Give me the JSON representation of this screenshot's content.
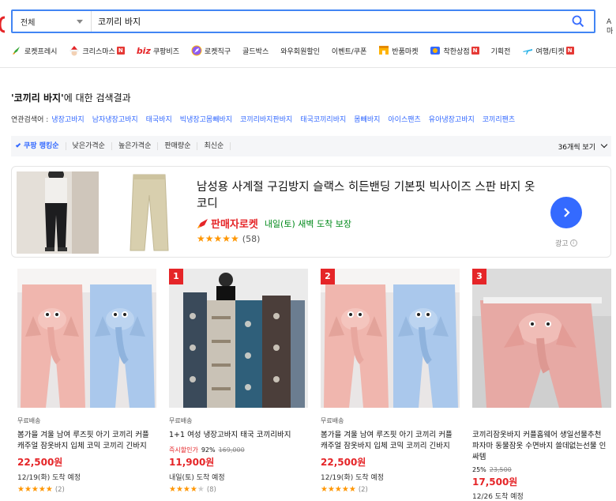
{
  "search": {
    "category": "전체",
    "query": "코끼리 바지"
  },
  "right_edge": {
    "line1": "A",
    "line2": "마"
  },
  "nav": [
    {
      "label": "로켓프레시",
      "icon": "rocket-fresh-icon",
      "badge": ""
    },
    {
      "label": "크리스마스",
      "icon": "santa-icon",
      "badge": "N"
    },
    {
      "label": "쿠팡비즈",
      "icon": "biz-icon",
      "prefix": "biz",
      "badge": ""
    },
    {
      "label": "로켓직구",
      "icon": "rocket-global-icon",
      "badge": ""
    },
    {
      "label": "골드박스",
      "icon": "",
      "badge": ""
    },
    {
      "label": "와우회원할인",
      "icon": "",
      "badge": ""
    },
    {
      "label": "이벤트/쿠폰",
      "icon": "",
      "badge": ""
    },
    {
      "label": "반품마켓",
      "icon": "market-icon",
      "badge": ""
    },
    {
      "label": "착한상점",
      "icon": "store-icon",
      "badge": "N"
    },
    {
      "label": "기획전",
      "icon": "",
      "badge": ""
    },
    {
      "label": "여행/티켓",
      "icon": "airplane-icon",
      "badge": "N"
    }
  ],
  "results": {
    "query_quoted": "'코끼리 바지'",
    "suffix": "에 대한 검색결과",
    "related_label": "연관검색어 :",
    "related": [
      "냉장고바지",
      "남자냉장고바지",
      "태국바지",
      "빅냉장고몸빼바지",
      "코끼리바지판바지",
      "태국코끼리바지",
      "몸빼바지",
      "아이스팬츠",
      "유아냉장고바지",
      "코끼리팬츠"
    ]
  },
  "sort": {
    "options": [
      "쿠팡 랭킹순",
      "낮은가격순",
      "높은가격순",
      "판매량순",
      "최신순"
    ],
    "active": 0,
    "view_count": "36개씩 보기"
  },
  "ad": {
    "title": "남성용 사계절 구김방지 슬랙스 히든밴딩 기본핏 빅사이즈 스판 바지 옷 코디",
    "rocket_label": "판매자로켓",
    "arrival": "내일(토) 새벽 도착 보장",
    "stars": "★★★★★",
    "review_count": "(58)",
    "label": "광고"
  },
  "products": [
    {
      "rank": "",
      "free_shipping": "무료배송",
      "name": "봄가을 겨울 남여 루즈핏 아기 코끼리 커플 캐주얼 잠옷바지 입체 코믹 코끼리 긴바지",
      "discount_label": "",
      "discount_pct": "",
      "original_price": "",
      "price": "22,500원",
      "delivery": "12/19(화) 도착 예정",
      "stars": 5,
      "reviews": "(2)",
      "image": "elephant-pants"
    },
    {
      "rank": "1",
      "free_shipping": "무료배송",
      "name": "1+1 여성 냉장고바지 태국 코끼리바지",
      "discount_label": "즉시할인가",
      "discount_pct": "92%",
      "original_price": "169,000",
      "price": "11,900원",
      "delivery": "내일(토) 도착 예정",
      "stars": 4,
      "reviews": "(8)",
      "image": "thai-pants"
    },
    {
      "rank": "2",
      "free_shipping": "무료배송",
      "name": "봄가을 겨울 남여 루즈핏 아기 코끼리 커플 캐주얼 잠옷바지 입체 코믹 코끼리 긴바지",
      "discount_label": "",
      "discount_pct": "",
      "original_price": "",
      "price": "22,500원",
      "delivery": "12/19(화) 도착 예정",
      "stars": 5,
      "reviews": "(2)",
      "image": "elephant-pants"
    },
    {
      "rank": "3",
      "free_shipping": "",
      "name": "코끼리잠옷바지 커플홈웨어 생일선물추천 파자마 동물잠옷 수면바지 쓸데없는선물 인싸템",
      "discount_label": "",
      "discount_pct": "25%",
      "original_price": "23,500",
      "price": "17,500원",
      "delivery": "12/26 도착 예정",
      "stars": 0,
      "reviews": "",
      "image": "pink-pants"
    }
  ],
  "colors": {
    "accent": "#346aff",
    "price": "#e52528",
    "search_border": "#4285f4",
    "arrival_green": "#00891a"
  }
}
